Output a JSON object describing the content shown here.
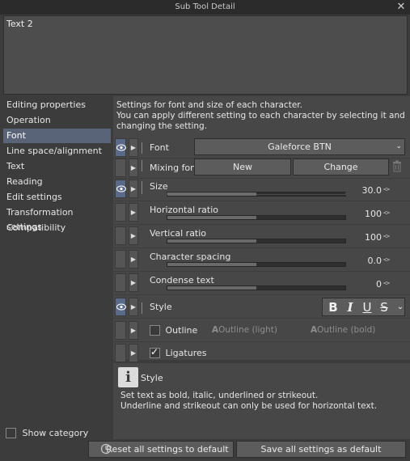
{
  "window": {
    "title": "Sub Tool Detail",
    "close_icon": "close-icon"
  },
  "preview": {
    "text": "Text 2"
  },
  "categories": [
    {
      "label": "Editing properties",
      "active": false
    },
    {
      "label": "Operation",
      "active": false
    },
    {
      "label": "Font",
      "active": true
    },
    {
      "label": "Line space/alignment",
      "active": false
    },
    {
      "label": "Text",
      "active": false
    },
    {
      "label": "Reading",
      "active": false
    },
    {
      "label": "Edit settings",
      "active": false
    },
    {
      "label": "Transformation settings",
      "active": false
    },
    {
      "label": "Compatibility",
      "active": false
    }
  ],
  "show_category": {
    "label": "Show category",
    "checked": false
  },
  "description": {
    "line1": "Settings for font and size of each character.",
    "line2": "You can apply different setting to each character by selecting it and",
    "line3": "changing the setting."
  },
  "settings": {
    "font": {
      "label": "Font",
      "value": "Galeforce BTN"
    },
    "mixing_font": {
      "label": "Mixing font",
      "new_label": "New",
      "change_label": "Change"
    },
    "size": {
      "label": "Size",
      "value": "30.0",
      "level": 0.5
    },
    "horizontal_ratio": {
      "label": "Horizontal ratio",
      "value": "100",
      "level": 0.5
    },
    "vertical_ratio": {
      "label": "Vertical ratio",
      "value": "100",
      "level": 0.5
    },
    "character_spacing": {
      "label": "Character spacing",
      "value": "0.0",
      "level": 0.5
    },
    "condense_text": {
      "label": "Condense text",
      "value": "0",
      "level": 0.5
    },
    "style": {
      "label": "Style",
      "bold": "B",
      "italic": "I",
      "underline": "U",
      "strike": "S"
    },
    "outline": {
      "label": "Outline",
      "checked": false,
      "light_label": "Outline (light)",
      "bold_label": "Outline (bold)"
    },
    "ligatures": {
      "label": "Ligatures",
      "checked": true
    }
  },
  "help": {
    "title": "Style",
    "line1": "Set text as bold, italic, underlined or strikeout.",
    "line2": "Underline and strikeout can only be used for horizontal text."
  },
  "footer": {
    "reset_label": "Reset all settings to default",
    "save_label": "Save all settings as default"
  }
}
